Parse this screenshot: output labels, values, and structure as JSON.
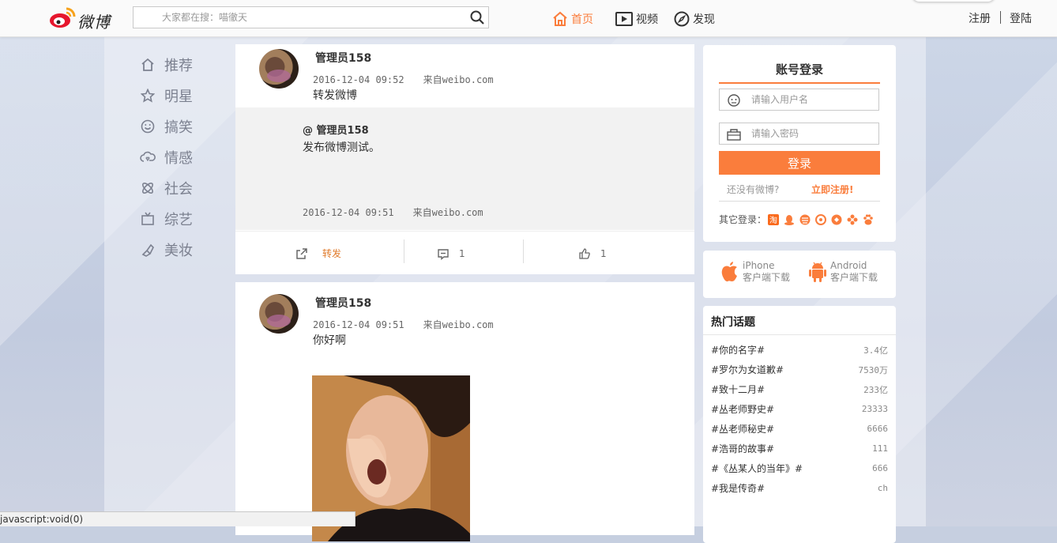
{
  "header": {
    "logo_text": "微博",
    "search_placeholder": "大家都在搜：喵徹天",
    "nav": {
      "home": "首页",
      "video": "视频",
      "discover": "发现"
    },
    "register": "注册",
    "login": "登陆"
  },
  "sidebar": {
    "items": [
      {
        "label": "推荐",
        "icon": "home-icon"
      },
      {
        "label": "明星",
        "icon": "star-icon"
      },
      {
        "label": "搞笑",
        "icon": "smile-icon"
      },
      {
        "label": "情感",
        "icon": "cloud-heart-icon"
      },
      {
        "label": "社会",
        "icon": "atom-icon"
      },
      {
        "label": "综艺",
        "icon": "tv-icon"
      },
      {
        "label": "美妆",
        "icon": "lipstick-icon"
      }
    ]
  },
  "feed": {
    "posts": [
      {
        "user": "管理员158",
        "time": "2016-12-04 09:52",
        "source": "来自weibo.com",
        "text": "转发微博",
        "repost": {
          "user": "@ 管理员158",
          "text": "发布微博测试。",
          "time": "2016-12-04 09:51",
          "source": "来自weibo.com"
        },
        "actions": {
          "forward": "转发",
          "comments": "1",
          "likes": "1"
        }
      },
      {
        "user": "管理员158",
        "time": "2016-12-04 09:51",
        "source": "来自weibo.com",
        "text": "你好啊"
      }
    ]
  },
  "login_panel": {
    "title": "账号登录",
    "username_placeholder": "请输入用户名",
    "password_placeholder": "请输入密码",
    "submit": "登录",
    "no_account": "还没有微博?",
    "register_now": "立即注册!",
    "other_login": "其它登录："
  },
  "apps": {
    "ios": {
      "name": "iPhone",
      "sub": "客户端下载"
    },
    "android": {
      "name": "Android",
      "sub": "客户端下载"
    }
  },
  "hot_topics": {
    "title": "热门话题",
    "items": [
      {
        "topic": "#你的名字#",
        "count": "3.4亿"
      },
      {
        "topic": "#罗尔为女道歉#",
        "count": "7530万"
      },
      {
        "topic": "#致十二月#",
        "count": "233亿"
      },
      {
        "topic": "#丛老师野史#",
        "count": "23333"
      },
      {
        "topic": "#丛老师秘史#",
        "count": "6666"
      },
      {
        "topic": "#浩哥的故事#",
        "count": "111"
      },
      {
        "topic": "#《丛某人的当年》#",
        "count": "666"
      },
      {
        "topic": "#我是传奇#",
        "count": "ch"
      }
    ]
  },
  "statusbar": {
    "text": "javascript:void(0)"
  },
  "colors": {
    "accent": "#fa7d3c",
    "text": "#333333",
    "muted": "#999999"
  }
}
